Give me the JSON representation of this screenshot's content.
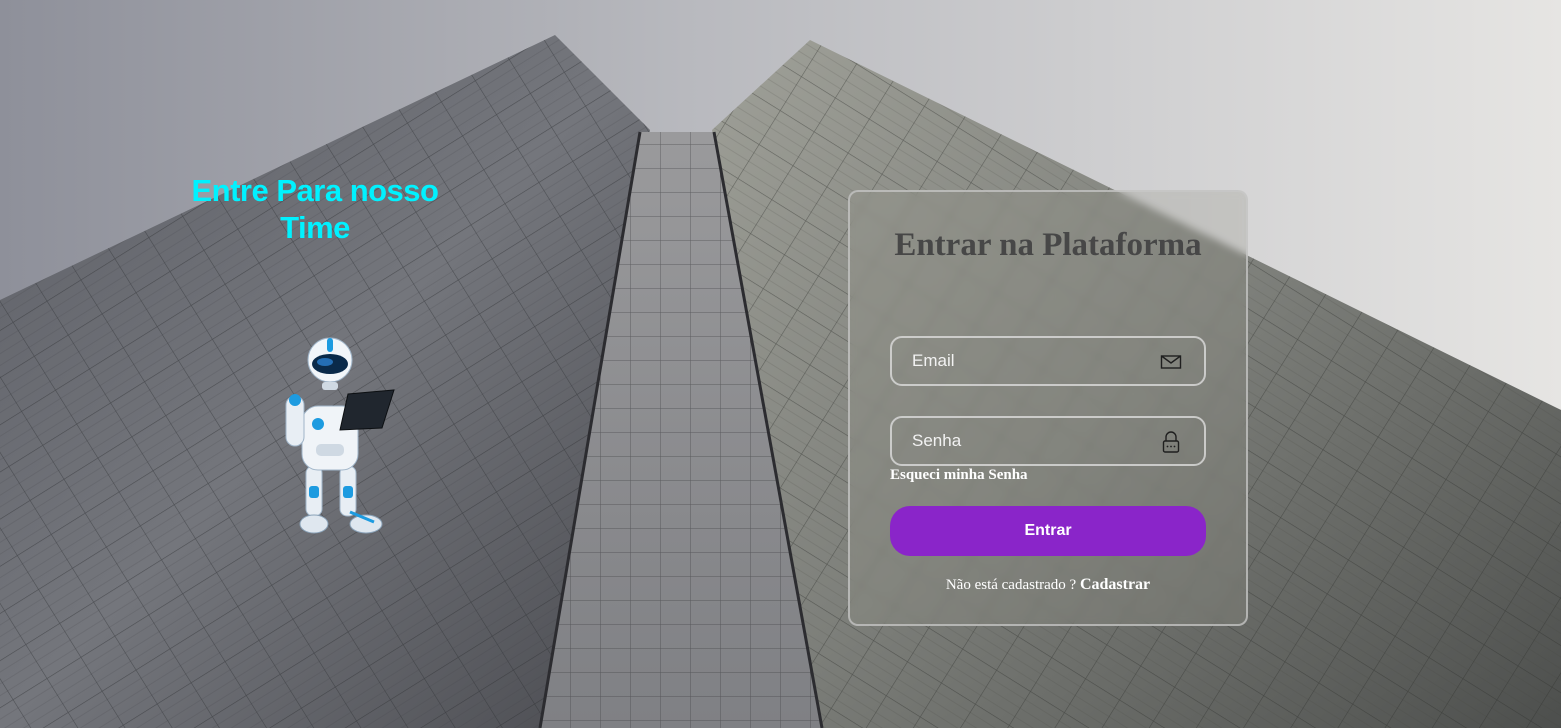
{
  "promo": {
    "headline": "Entre Para nosso Time"
  },
  "login": {
    "title": "Entrar na Plataforma",
    "email_placeholder": "Email",
    "password_placeholder": "Senha",
    "forgot_password": "Esqueci minha Senha",
    "submit_label": "Entrar",
    "register_prompt": "Não está cadastrado ?",
    "register_link": "Cadastrar"
  },
  "icons": {
    "email": "envelope-icon",
    "password": "lock-icon"
  },
  "colors": {
    "headline": "#00f2ff",
    "submit_button": "#8a25c9",
    "title": "#474747"
  }
}
